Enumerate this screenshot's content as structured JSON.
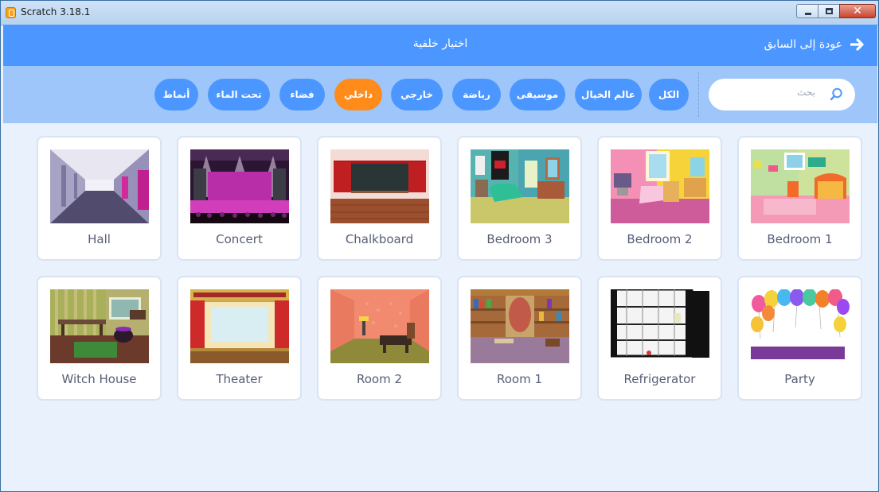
{
  "window": {
    "title": "Scratch 3.18.1",
    "controls": {
      "minimize": "minimize",
      "maximize": "maximize",
      "close": "✕"
    }
  },
  "header": {
    "title": "اختيار خلفية",
    "back_label": "عودة إلى السابق",
    "back_icon": "arrow-right-icon"
  },
  "search": {
    "placeholder": "بحث",
    "value": ""
  },
  "tags": [
    {
      "label": "الكل",
      "active": false
    },
    {
      "label": "عالم الخيال",
      "active": false
    },
    {
      "label": "موسيقى",
      "active": false
    },
    {
      "label": "رياضة",
      "active": false
    },
    {
      "label": "خارجي",
      "active": false
    },
    {
      "label": "داخلي",
      "active": true
    },
    {
      "label": "فضاء",
      "active": false
    },
    {
      "label": "تحت الماء",
      "active": false
    },
    {
      "label": "أنماط",
      "active": false
    }
  ],
  "backdrops": [
    {
      "name": "Hall"
    },
    {
      "name": "Concert"
    },
    {
      "name": "Chalkboard"
    },
    {
      "name": "Bedroom 3"
    },
    {
      "name": "Bedroom 2"
    },
    {
      "name": "Bedroom 1"
    },
    {
      "name": "Witch House"
    },
    {
      "name": "Theater"
    },
    {
      "name": "Room 2"
    },
    {
      "name": "Room 1"
    },
    {
      "name": "Refrigerator"
    },
    {
      "name": "Party"
    }
  ],
  "colors": {
    "header": "#4c97ff",
    "filter_bar": "#9fc6fb",
    "tag": "#4c97ff",
    "tag_active": "#ff8c1a",
    "content_bg": "#e9f1fc",
    "card_label": "#575e75"
  }
}
